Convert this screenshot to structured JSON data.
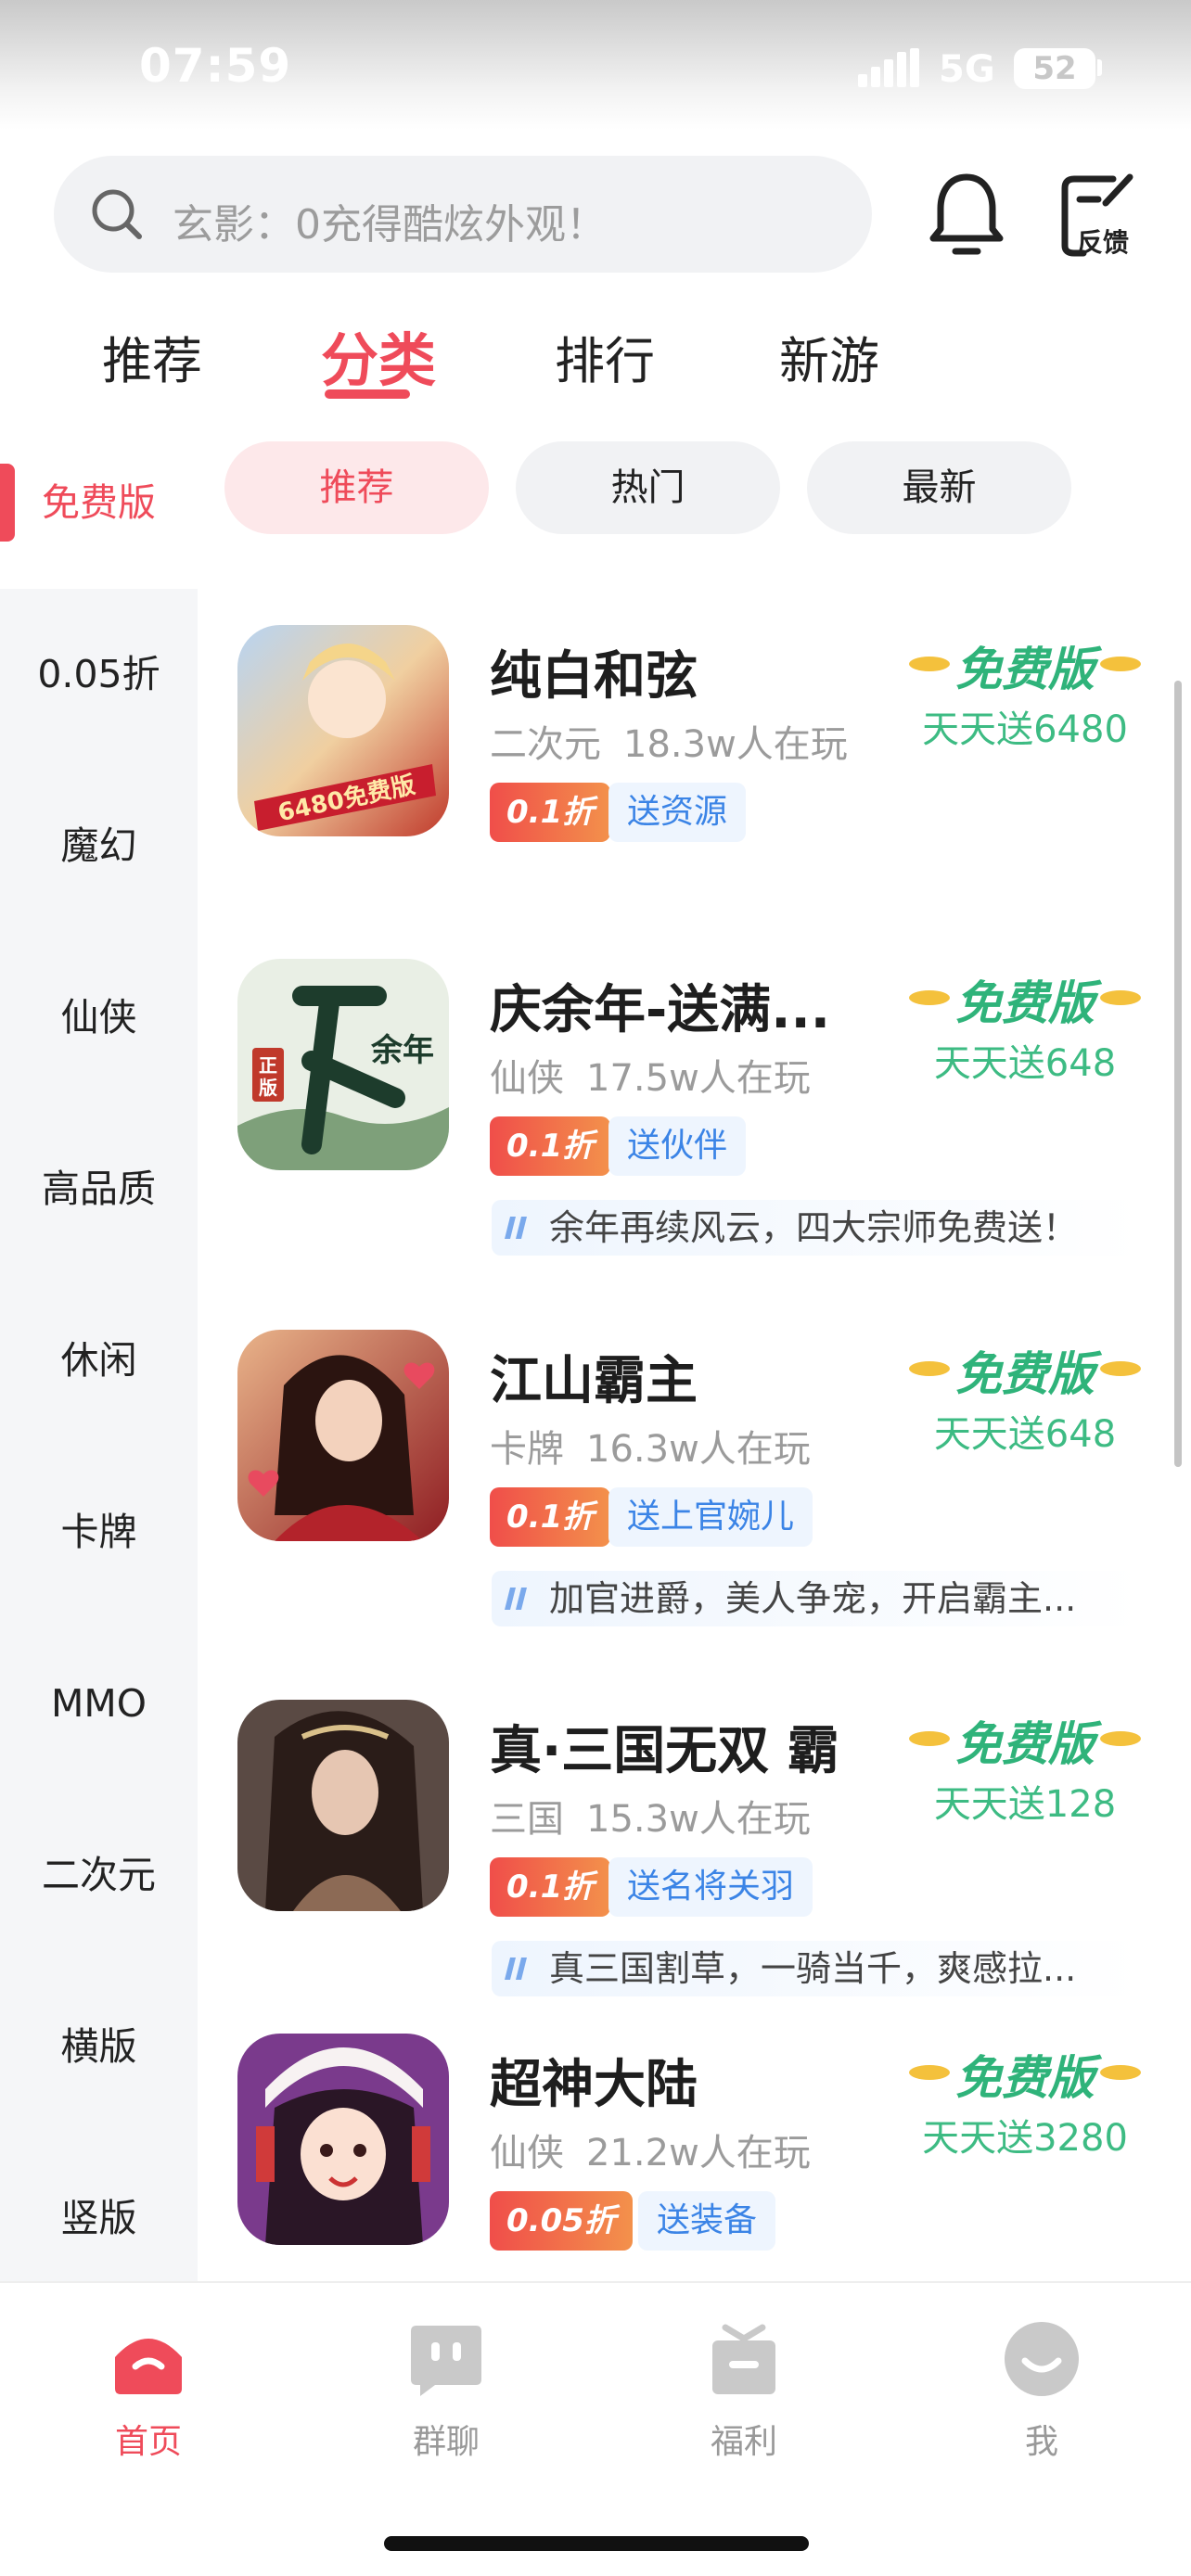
{
  "status_bar": {
    "time": "07:59",
    "network": "5G",
    "battery": "52"
  },
  "search": {
    "placeholder": "玄影：0充得酷炫外观！"
  },
  "header": {
    "feedback_label": "反馈"
  },
  "main_tabs": [
    {
      "label": "推荐"
    },
    {
      "label": "分类",
      "active": true
    },
    {
      "label": "排行"
    },
    {
      "label": "新游"
    }
  ],
  "side_nav": [
    {
      "label": "免费版",
      "active": true
    },
    {
      "label": "0.05折"
    },
    {
      "label": "魔幻"
    },
    {
      "label": "仙侠"
    },
    {
      "label": "高品质"
    },
    {
      "label": "休闲"
    },
    {
      "label": "卡牌"
    },
    {
      "label": "MMO"
    },
    {
      "label": "二次元"
    },
    {
      "label": "横版"
    },
    {
      "label": "竖版"
    }
  ],
  "sub_tabs": [
    {
      "label": "推荐",
      "active": true
    },
    {
      "label": "热门"
    },
    {
      "label": "最新"
    }
  ],
  "games": [
    {
      "name": "纯白和弦",
      "genre": "二次元",
      "players": "18.3w人在玩",
      "discount": "0.1折",
      "gift": "送资源",
      "badge": "免费版",
      "daily_gift": "天天送6480",
      "tagline": "",
      "icon_text": "6480免费版"
    },
    {
      "name": "庆余年-送满...",
      "genre": "仙侠",
      "players": "17.5w人在玩",
      "discount": "0.1折",
      "gift": "送伙伴",
      "badge": "免费版",
      "daily_gift": "天天送648",
      "tagline": "余年再续风云，四大宗师免费送！",
      "icon_text": "余年"
    },
    {
      "name": "江山霸主",
      "genre": "卡牌",
      "players": "16.3w人在玩",
      "discount": "0.1折",
      "gift": "送上官婉儿",
      "badge": "免费版",
      "daily_gift": "天天送648",
      "tagline": "加官进爵，美人争宠，开启霸主..."
    },
    {
      "name": "真·三国无双 霸",
      "genre": "三国",
      "players": "15.3w人在玩",
      "discount": "0.1折",
      "gift": "送名将关羽",
      "badge": "免费版",
      "daily_gift": "天天送128",
      "tagline": "真三国割草，一骑当千，爽感拉..."
    },
    {
      "name": "超神大陆",
      "genre": "仙侠",
      "players": "21.2w人在玩",
      "discount": "0.05折",
      "gift": "送装备",
      "badge": "免费版",
      "daily_gift": "天天送3280",
      "tagline": ""
    }
  ],
  "bottom_nav": [
    {
      "label": "首页",
      "active": true,
      "icon": "home-icon"
    },
    {
      "label": "群聊",
      "icon": "chat-icon"
    },
    {
      "label": "福利",
      "icon": "gift-icon"
    },
    {
      "label": "我",
      "icon": "profile-icon"
    }
  ],
  "colors": {
    "accent": "#ef4b5a",
    "free_green": "#2fb37a",
    "gift_blue": "#3b84e6"
  }
}
